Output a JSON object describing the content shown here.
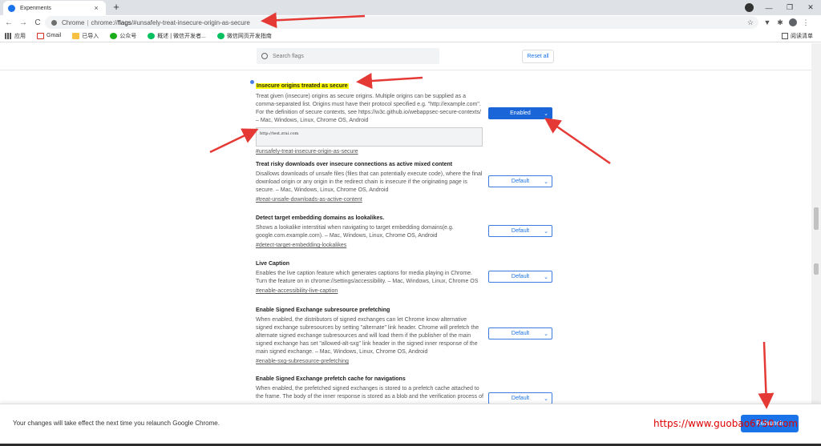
{
  "tab": {
    "title": "Experiments",
    "close": "×",
    "new": "+"
  },
  "window": {
    "minimize": "—",
    "restore": "❐",
    "close": "✕"
  },
  "toolbar": {
    "back": "←",
    "forward": "→",
    "reload": "C",
    "scheme": "Chrome",
    "url_pre": "chrome://",
    "url_host": "flags",
    "url_rest": "/#unsafely-treat-insecure-origin-as-secure",
    "star": "☆"
  },
  "bookmarks": [
    {
      "label": "应用",
      "icon": "apps-grid-icon"
    },
    {
      "label": "Gmail",
      "icon": "gmail-icon"
    },
    {
      "label": "已导入",
      "icon": "folder-icon"
    },
    {
      "label": "公众号",
      "icon": "wechat-icon"
    },
    {
      "label": "概述 | 微信开发者...",
      "icon": "wechat-dev-icon"
    },
    {
      "label": "微信网页开发指南",
      "icon": "wechat-web-icon"
    }
  ],
  "reading_list": "阅读清单",
  "search": {
    "placeholder": "Search flags"
  },
  "reset_all": "Reset all",
  "flags": [
    {
      "title": "Insecure origins treated as secure",
      "desc": "Treat given (insecure) origins as secure origins. Multiple origins can be supplied as a comma-separated list. Origins must have their protocol specified e.g. \"http://example.com\". For the definition of secure contexts, see https://w3c.github.io/webappsec-secure-contexts/ – Mac, Windows, Linux, Chrome OS, Android",
      "value_input": "http://test.zrai.com",
      "tag": "#unsafely-treat-insecure-origin-as-secure",
      "state": "Enabled"
    },
    {
      "title": "Treat risky downloads over insecure connections as active mixed content",
      "desc": "Disallows downloads of unsafe files (files that can potentially execute code), where the final download origin or any origin in the redirect chain is insecure if the originating page is secure. – Mac, Windows, Linux, Chrome OS, Android",
      "tag": "#treat-unsafe-downloads-as-active-content",
      "state": "Default"
    },
    {
      "title": "Detect target embedding domains as lookalikes.",
      "desc": "Shows a lookalike interstitial when navigating to target embedding domains(e.g. google.com.example.com). – Mac, Windows, Linux, Chrome OS, Android",
      "tag": "#detect-target-embedding-lookalikes",
      "state": "Default"
    },
    {
      "title": "Live Caption",
      "desc": "Enables the live caption feature which generates captions for media playing in Chrome. Turn the feature on in chrome://settings/accessibility. – Mac, Windows, Linux, Chrome OS",
      "tag": "#enable-accessibility-live-caption",
      "state": "Default"
    },
    {
      "title": "Enable Signed Exchange subresource prefetching",
      "desc": "When enabled, the distributors of signed exchanges can let Chrome know alternative signed exchange subresources by setting \"alternate\" link header. Chrome will prefetch the alternate signed exchange subresources and will load them if the publisher of the main signed exchange has set \"allowed-alt-sxg\" link header in the signed inner response of the main signed exchange. – Mac, Windows, Linux, Chrome OS, Android",
      "tag": "#enable-sxg-subresource-prefetching",
      "state": "Default"
    },
    {
      "title": "Enable Signed Exchange prefetch cache for navigations",
      "desc": "When enabled, the prefetched signed exchanges is stored to a prefetch cache attached to the frame. The body of the inner response is stored as a blob and the verification process of",
      "state": "Default"
    }
  ],
  "banner": {
    "message": "Your changes will take effect the next time you relaunch Google Chrome.",
    "relaunch": "Relaunch",
    "watermark": "https://www.guobao6750.com"
  },
  "colors": {
    "accent": "#1a73e8",
    "highlight": "#ffff00",
    "arrow": "#e53935"
  }
}
